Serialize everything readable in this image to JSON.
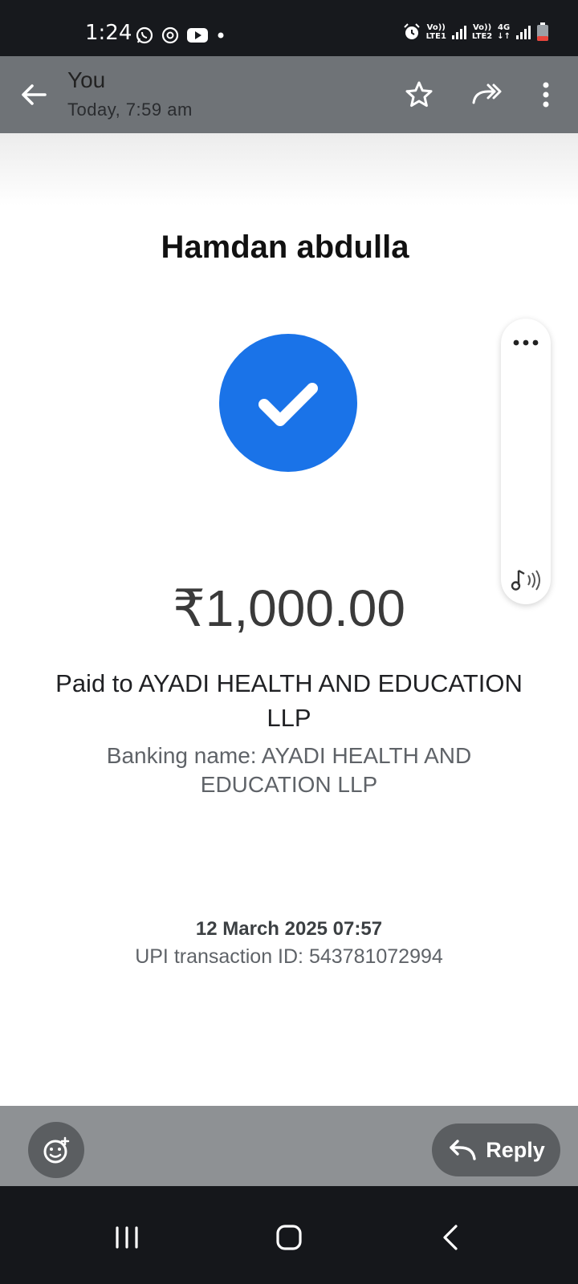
{
  "status_bar": {
    "time": "1:24",
    "sim1_label_top": "Vo))",
    "sim1_label_bottom": "LTE1",
    "sim2_label_top": "Vo))",
    "sim2_label_bottom": "LTE2",
    "network_type": "4G"
  },
  "header": {
    "sender": "You",
    "timestamp": "Today, 7:59 am"
  },
  "receipt": {
    "payer_name": "Hamdan abdulla",
    "amount": "₹1,000.00",
    "paid_to": "Paid to AYADI HEALTH AND EDUCATION LLP",
    "banking_name": "Banking name: AYADI HEALTH AND EDUCATION LLP",
    "datetime": "12 March 2025 07:57",
    "upi_transaction": "UPI transaction ID: 543781072994"
  },
  "actions": {
    "reply_label": "Reply"
  },
  "colors": {
    "accent_blue": "#1a73e8",
    "header_bg": "#6f7377",
    "action_bar_bg": "#8e9194"
  }
}
